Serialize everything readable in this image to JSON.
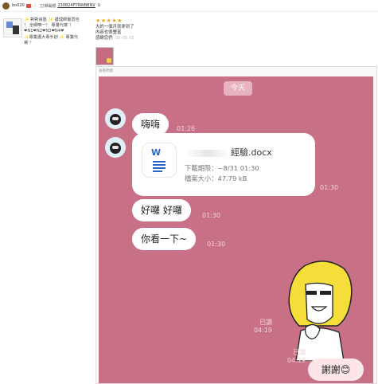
{
  "topbar": {
    "username": "bo020",
    "order_label": "訂單編號",
    "order_number": "230824FTRWBBNV"
  },
  "product": {
    "lines": [
      "✨ 對對良塾 ✨ 護理師實習包",
      "！ 全網唯一！ 專業代寫 ！",
      "❤N1❤N2❤N3❤N4❤",
      "✨專業護大專手創 ✨ 專業代",
      "寫 ！"
    ]
  },
  "review": {
    "stars": "★★★★★",
    "line1": "大約一個月就拿到了",
    "line2": "內容也很豐富",
    "line3": "感謝您們",
    "timestamp": "05-05 05"
  },
  "screenshot": {
    "label": "查看原圖",
    "today": "今天",
    "msg1": {
      "text": "嗨嗨",
      "time": "01:26"
    },
    "file": {
      "name_suffix": "經驗.docx",
      "name_end": "x",
      "deadline": "下載期限：~8/31 01:30",
      "size": "檔案大小：47.79 kB",
      "time": "01:30"
    },
    "msg2": {
      "text": "好囉 好囉",
      "time": "01:30"
    },
    "msg3": {
      "text": "你看一下~",
      "time": "01:30"
    },
    "read1": {
      "label": "已讀",
      "time": "04:19"
    },
    "read2": {
      "label": "已讀",
      "time": "04:19"
    },
    "thanks": "謝謝😊"
  },
  "colors": {
    "chat_bg": "#c87186",
    "star": "#f0a21b",
    "word_blue": "#2a66c8"
  }
}
